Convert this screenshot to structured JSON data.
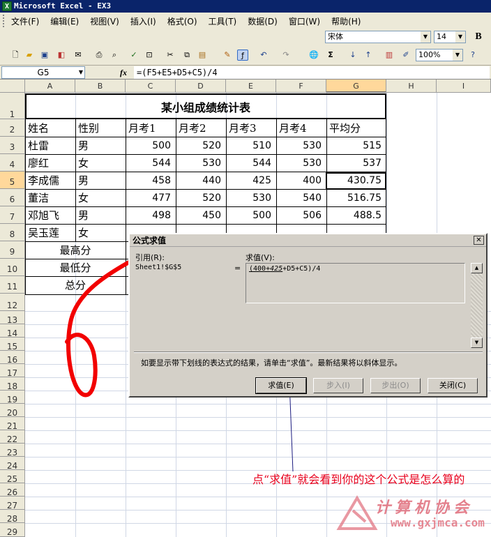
{
  "window": {
    "title": "Microsoft Excel - EX3",
    "app_icon": "excel-icon"
  },
  "menu": [
    "文件(F)",
    "编辑(E)",
    "视图(V)",
    "插入(I)",
    "格式(O)",
    "工具(T)",
    "数据(D)",
    "窗口(W)",
    "帮助(H)"
  ],
  "font_toolbar": {
    "font": "宋体",
    "size": "14",
    "bold": "B"
  },
  "standard_toolbar": {
    "zoom": "100%"
  },
  "formula_bar": {
    "name_box": "G5",
    "fx": "fx",
    "formula": "=(F5+E5+D5+C5)/4"
  },
  "columns": [
    "A",
    "B",
    "C",
    "D",
    "E",
    "F",
    "G",
    "H",
    "I"
  ],
  "rows": [
    "1",
    "2",
    "3",
    "4",
    "5",
    "6",
    "7",
    "8",
    "9",
    "10",
    "11",
    "12",
    "13",
    "14",
    "15",
    "16",
    "17",
    "18",
    "19",
    "20",
    "21",
    "22",
    "23",
    "24",
    "25",
    "26",
    "27",
    "28",
    "29"
  ],
  "table": {
    "title": "某小组成绩统计表",
    "headers": [
      "姓名",
      "性别",
      "月考1",
      "月考2",
      "月考3",
      "月考4",
      "平均分"
    ],
    "rows": [
      [
        "杜雷",
        "男",
        "500",
        "520",
        "510",
        "530",
        "515"
      ],
      [
        "廖红",
        "女",
        "544",
        "530",
        "544",
        "530",
        "537"
      ],
      [
        "李成儒",
        "男",
        "458",
        "440",
        "425",
        "400",
        "430.75"
      ],
      [
        "董洁",
        "女",
        "477",
        "520",
        "530",
        "540",
        "516.75"
      ],
      [
        "邓旭飞",
        "男",
        "498",
        "450",
        "500",
        "506",
        "488.5"
      ],
      [
        "吴玉莲",
        "女",
        "",
        "",
        "",
        "",
        ""
      ]
    ],
    "summary": [
      "最高分",
      "最低分",
      "总分"
    ]
  },
  "dialog": {
    "title": "公式求值",
    "ref_label": "引用(R):",
    "ref_value": "Sheet1!$G$5",
    "eq": "=",
    "eval_label": "求值(V):",
    "eval_pre": "(400+",
    "eval_ital": "425",
    "eval_post": "+D5+C5)/4",
    "hint": "如要显示带下划线的表达式的结果，请单击“求值”。最新结果将以斜体显示。",
    "buttons": {
      "evaluate": "求值(E)",
      "step_in": "步入(I)",
      "step_out": "步出(O)",
      "close": "关闭(C)"
    }
  },
  "annotation": {
    "text": "点“求值”就会看到你的这个公式是怎么算的",
    "handwritten": "6"
  },
  "watermark": {
    "name": "计算机协会",
    "url": "www.gxjmca.com"
  }
}
